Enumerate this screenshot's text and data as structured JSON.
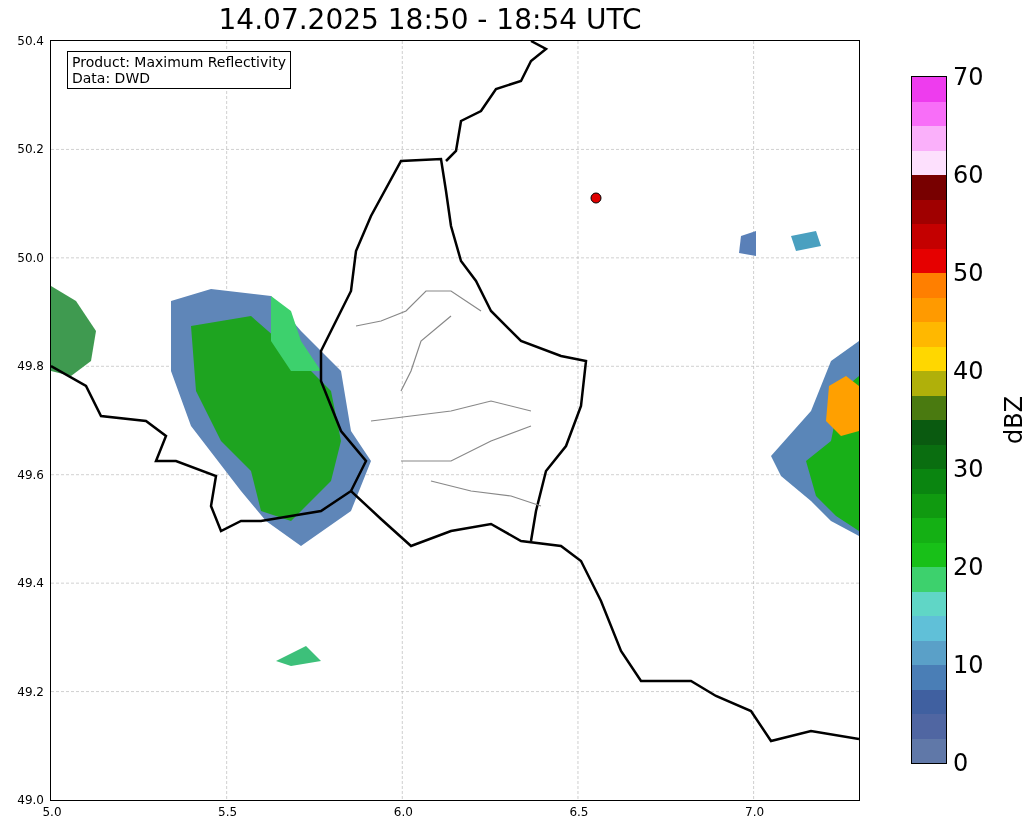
{
  "title": "14.07.2025 18:50 - 18:54 UTC",
  "info_box": [
    "Product: Maximum Reflectivity",
    "Data: DWD"
  ],
  "y_ticks": [
    "50.4",
    "50.2",
    "50.0",
    "49.8",
    "49.6",
    "49.4",
    "49.2",
    "49.0"
  ],
  "x_ticks": [
    "5.0",
    "5.5",
    "6.0",
    "6.5",
    "7.0"
  ],
  "colorbar": {
    "label": "dBZ",
    "ticks": [
      "70",
      "60",
      "50",
      "40",
      "30",
      "20",
      "10",
      "0"
    ],
    "segments": [
      {
        "color": "#ee3cee"
      },
      {
        "color": "#f86ef8"
      },
      {
        "color": "#fab0fa"
      },
      {
        "color": "#fde0fd"
      },
      {
        "color": "#780000"
      },
      {
        "color": "#a00000"
      },
      {
        "color": "#c40000"
      },
      {
        "color": "#e60000"
      },
      {
        "color": "#ff7f00"
      },
      {
        "color": "#ff9a00"
      },
      {
        "color": "#ffb800"
      },
      {
        "color": "#ffd700"
      },
      {
        "color": "#b0b00a"
      },
      {
        "color": "#4a7a10"
      },
      {
        "color": "#0a5a10"
      },
      {
        "color": "#0a6e10"
      },
      {
        "color": "#0a8510"
      },
      {
        "color": "#109a10"
      },
      {
        "color": "#14b014"
      },
      {
        "color": "#18c018"
      },
      {
        "color": "#3dd16d"
      },
      {
        "color": "#60d6c6"
      },
      {
        "color": "#60c0d8"
      },
      {
        "color": "#5aa0c8"
      },
      {
        "color": "#4a7eb6"
      },
      {
        "color": "#4060a0"
      },
      {
        "color": "#5066a2"
      },
      {
        "color": "#6078a8"
      }
    ]
  }
}
